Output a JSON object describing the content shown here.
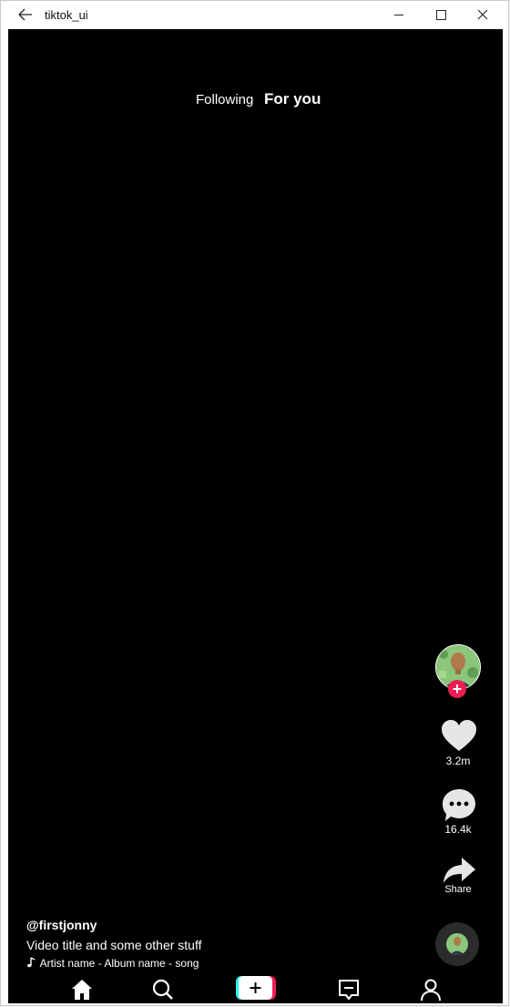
{
  "window": {
    "title": "tiktok_ui"
  },
  "feed": {
    "tabs": {
      "following": "Following",
      "for_you": "For you"
    }
  },
  "actions": {
    "like_count": "3.2m",
    "comment_count": "16.4k",
    "share_label": "Share"
  },
  "post": {
    "username": "@firstjonny",
    "title": "Video title and some other stuff",
    "music": "Artist name - Album name - song"
  },
  "colors": {
    "accent_red": "#ee1d52",
    "accent_cyan": "#25f4ee",
    "background": "#000000"
  },
  "icons": {
    "back": "arrow-left-icon",
    "like": "heart-icon",
    "comment": "chat-bubble-icon",
    "share": "share-arrow-icon",
    "home": "home-icon",
    "search": "search-icon",
    "create": "plus-icon",
    "inbox": "inbox-icon",
    "profile": "person-icon"
  }
}
